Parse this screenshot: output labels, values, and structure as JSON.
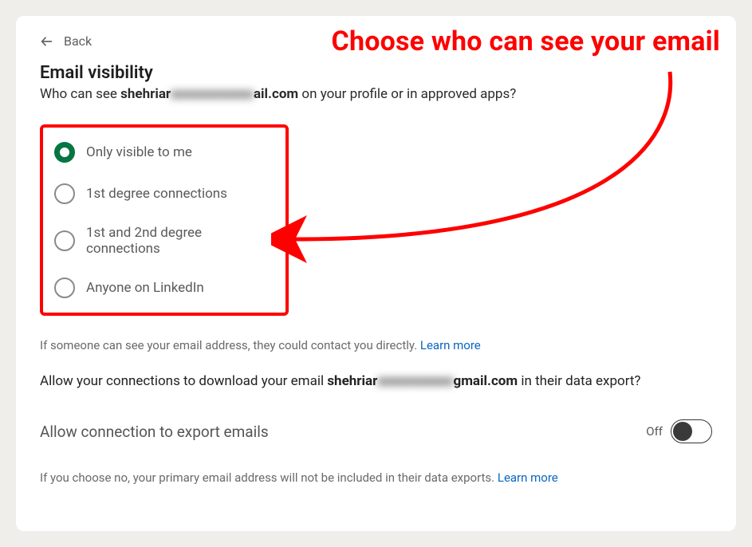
{
  "annotation": {
    "title": "Choose who can see your email"
  },
  "back_label": "Back",
  "heading": "Email visibility",
  "subtitle_prefix": "Who can see ",
  "subtitle_email_visible_part1": "shehriar",
  "subtitle_email_blurred": "xxxxxxxxxxxx",
  "subtitle_email_visible_part2": "ail.com",
  "subtitle_suffix": " on your profile or in approved apps?",
  "options": [
    {
      "label": "Only visible to me",
      "selected": true
    },
    {
      "label": "1st degree connections",
      "selected": false
    },
    {
      "label": "1st and 2nd degree connections",
      "selected": false
    },
    {
      "label": "Anyone on LinkedIn",
      "selected": false
    }
  ],
  "hint1_text": "If someone can see your email address, they could contact you directly. ",
  "hint1_link": "Learn more",
  "question2_prefix": "Allow your connections to download your email ",
  "question2_email_visible_part1": "shehriar",
  "question2_email_blurred": "xxxxxxxxxxx",
  "question2_email_visible_part2": "gmail.com",
  "question2_suffix": " in their data export?",
  "toggle_label": "Allow connection to export emails",
  "toggle_state": "Off",
  "hint2_text": "If you choose no, your primary email address will not be included in their data exports. ",
  "hint2_link": "Learn more"
}
